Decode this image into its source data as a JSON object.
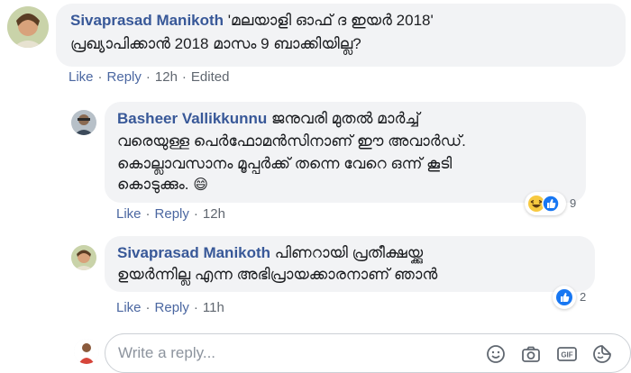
{
  "comments": [
    {
      "author": "Sivaprasad Manikoth",
      "text_lines": [
        "'മലയാളി ഓഫ് ദ ഇയർ 2018'",
        "പ്രഖ്യാപിക്കാൻ 2018 മാസം 9 ബാക്കിയില്ല?"
      ],
      "actions": {
        "like": "Like",
        "reply": "Reply",
        "time": "12h",
        "edited": "Edited"
      }
    },
    {
      "author": "Basheer Vallikkunnu",
      "text_lines": [
        "ജനുവരി മുതൽ മാർച്ച്",
        "വരെയുള്ള പെർഫോമൻസിനാണ് ഈ അവാർഡ്.",
        "കൊല്ലാവസാനം മൂപ്പർക്ക് തന്നെ വേറെ ഒന്ന് കൂടി",
        "കൊടുക്കും."
      ],
      "emoji": "😄",
      "actions": {
        "like": "Like",
        "reply": "Reply",
        "time": "12h"
      },
      "reactions": {
        "icons": [
          "haha-icon",
          "like-icon"
        ],
        "count": "9"
      }
    },
    {
      "author": "Sivaprasad Manikoth",
      "text_lines": [
        "പിണറായി പ്രതീക്ഷയ്ക്കു",
        "ഉയർന്നില്ല എന്ന അഭിപ്രായക്കാരനാണ് ഞാൻ"
      ],
      "actions": {
        "like": "Like",
        "reply": "Reply",
        "time": "11h"
      },
      "reactions": {
        "icons": [
          "like-icon"
        ],
        "count": "2"
      }
    }
  ],
  "reply_box": {
    "placeholder": "Write a reply...",
    "tools": [
      "emoji-icon",
      "camera-icon",
      "gif-icon",
      "sticker-icon"
    ]
  },
  "colors": {
    "name": "#385898",
    "link": "#4b67a1",
    "bubble": "#f2f3f5",
    "like_blue": "#1877f2"
  }
}
